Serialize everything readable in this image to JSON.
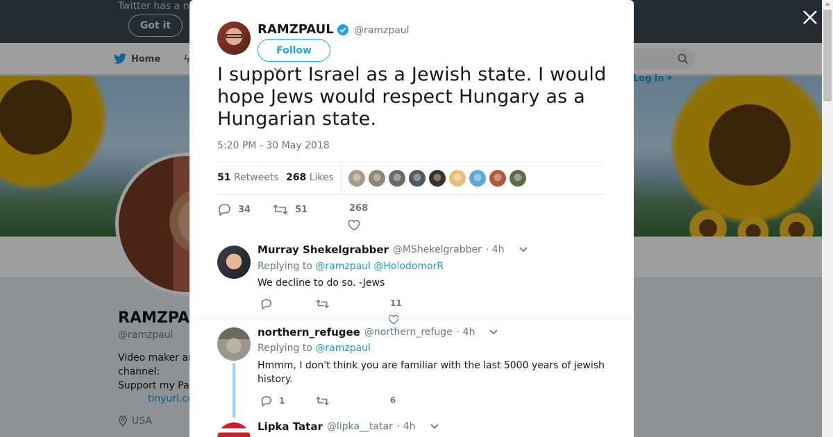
{
  "background": {
    "banner_text": "Twitter has a n",
    "got_it_label": "Got it",
    "nav_home_label": "Home",
    "login_label": "Log in",
    "profile_name": "RAMZPAUL",
    "profile_handle": "@ramzpaul",
    "bio_line1": "Video maker ar",
    "bio_line2": "channel:",
    "bio_line3": "Support my Pa",
    "bio_link": "tinyurl.co",
    "location": "USA"
  },
  "tweet": {
    "author_name": "RAMZPAUL",
    "author_handle": "@ramzpaul",
    "follow_label": "Follow",
    "text": "I support Israel as a Jewish state. I would hope Jews would respect Hungary as a Hungarian state.",
    "timestamp": "5:20 PM - 30 May 2018",
    "retweets_count": "51",
    "retweets_label": "Retweets",
    "likes_count": "268",
    "likes_label": "Likes",
    "reply_count": "34",
    "retweet_action_count": "51",
    "like_action_count": "268"
  },
  "likers": [
    {
      "color": "#a99b8c"
    },
    {
      "color": "#8d8575"
    },
    {
      "color": "#6b6b6b"
    },
    {
      "color": "#4e5a62"
    },
    {
      "color": "#3b3129"
    },
    {
      "color": "#e6c07a"
    },
    {
      "color": "#5fa7d6"
    },
    {
      "color": "#b0593a"
    },
    {
      "color": "#5c6b4a"
    }
  ],
  "replies": [
    {
      "name": "Murray Shekelgrabber",
      "handle": "@MShekelgrabber",
      "time": "· 4h",
      "replying_label": "Replying to",
      "mentions": "@ramzpaul @HolodomorR",
      "text": "We decline to do so. -Jews",
      "reply_count": "",
      "retweet_count": "",
      "like_count": "11"
    },
    {
      "name": "northern_refugee",
      "handle": "@northern_refuge",
      "time": "· 4h",
      "replying_label": "Replying to",
      "mentions": "@ramzpaul",
      "text": "Hmmm, I don't think you are familiar with the last 5000 years of jewish history.",
      "reply_count": "1",
      "retweet_count": "",
      "like_count": "6"
    },
    {
      "name": "Lipka Tatar",
      "handle": "@lipka__tatar",
      "time": "· 4h"
    }
  ],
  "colors": {
    "accent": "#1da1f2",
    "link": "#1b95e0",
    "muted": "#657786",
    "thread_line": "#9ad0ef"
  }
}
